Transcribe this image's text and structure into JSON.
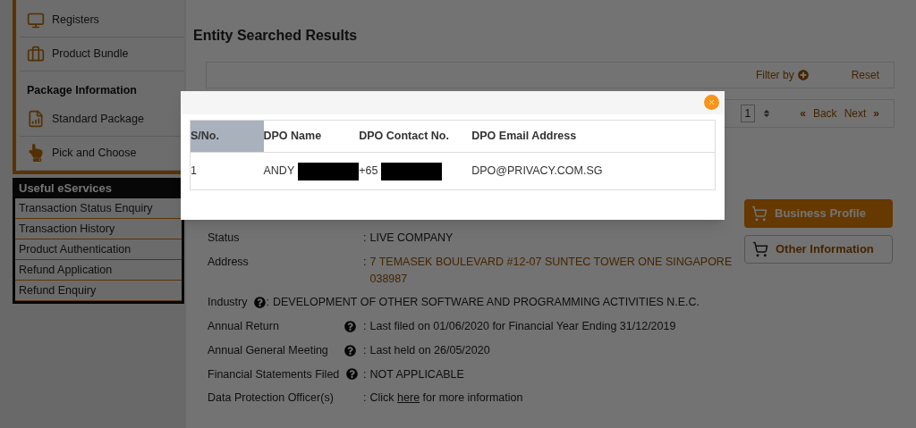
{
  "sidebar": {
    "items": [
      {
        "label": "Registers"
      },
      {
        "label": "Product Bundle"
      }
    ],
    "package_heading": "Package Information",
    "package_items": [
      {
        "label": "Standard Package"
      },
      {
        "label": "Pick and Choose"
      }
    ],
    "eservices": {
      "title": "Useful eServices",
      "items": [
        "Transaction Status Enquiry",
        "Transaction History",
        "Product Authentication",
        "Refund Application",
        "Refund Enquiry"
      ]
    }
  },
  "page": {
    "title": "Entity Searched Results",
    "filter_label": "Filter by",
    "reset": "Reset",
    "pager": {
      "page": "1",
      "back": "Back",
      "next": "Next",
      "first_glyph": "«",
      "last_glyph": "»"
    },
    "details": [
      {
        "kind": "plain",
        "label": "Status",
        "separator": ":",
        "value": "LIVE COMPANY"
      },
      {
        "kind": "link",
        "label": "Address",
        "separator": ":",
        "value": "7 TEMASEK BOULEVARD #12-07 SUNTEC TOWER ONE SINGAPORE 038987"
      },
      {
        "kind": "inline_help",
        "label": "Industry",
        "separator": ":",
        "value": "DEVELOPMENT OF OTHER SOFTWARE AND PROGRAMMING ACTIVITIES N.E.C."
      },
      {
        "kind": "help",
        "label": "Annual Return",
        "separator": ":",
        "value": "Last filed on 01/06/2020 for Financial Year Ending 31/12/2019"
      },
      {
        "kind": "help",
        "label": "Annual General Meeting",
        "separator": ":",
        "value": "Last held on 26/05/2020"
      },
      {
        "kind": "help",
        "label": "Financial Statements Filed",
        "separator": ":",
        "value": "NOT APPLICABLE"
      }
    ],
    "dpo": {
      "label": "Data Protection Officer(s)",
      "separator": ":",
      "before": "Click",
      "link": "here",
      "after": "for more information"
    },
    "buttons": [
      {
        "label": "Business Profile",
        "primary": true
      },
      {
        "label": "Other Information",
        "primary": false
      }
    ]
  },
  "modal": {
    "columns": [
      {
        "label": "S/No.",
        "selected": true
      },
      {
        "label": "DPO Name",
        "selected": false
      },
      {
        "label": "DPO Contact No.",
        "selected": false
      },
      {
        "label": "DPO Email Address",
        "selected": false
      }
    ],
    "rows": [
      [
        {
          "text": "1",
          "redacted": false
        },
        {
          "text": "ANDY",
          "redacted": true
        },
        {
          "text": "+65",
          "redacted": true
        },
        {
          "text": "DPO@PRIVACY.COM.SG",
          "redacted": false
        }
      ]
    ]
  }
}
